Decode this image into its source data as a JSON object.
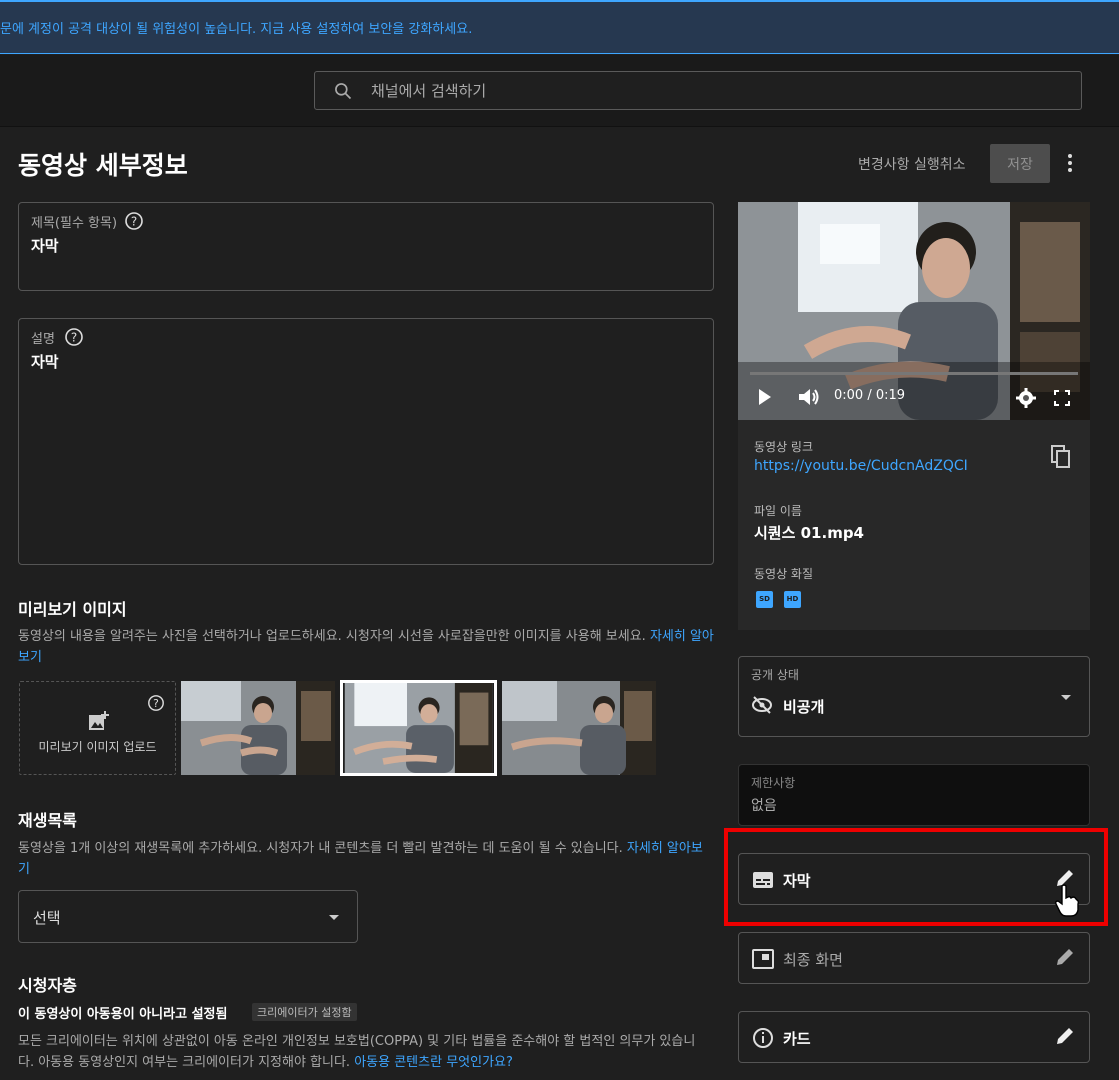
{
  "banner": {
    "text": "문에 계정이 공격 대상이 될 위험성이 높습니다. 지금 사용 설정하여 보안을 강화하세요."
  },
  "search": {
    "placeholder": "채널에서 검색하기"
  },
  "header": {
    "title": "동영상 세부정보",
    "undo_label": "변경사항 실행취소",
    "save_label": "저장"
  },
  "title_field": {
    "label": "제목(필수 항목)",
    "value": "자막"
  },
  "description_field": {
    "label": "설명",
    "value": "자막"
  },
  "thumbnail": {
    "heading": "미리보기 이미지",
    "desc": "동영상의 내용을 알려주는 사진을 선택하거나 업로드하세요. 시청자의 시선을 사로잡을만한 이미지를 사용해 보세요.",
    "learn_more": "자세히 알아보기",
    "upload_label": "미리보기 이미지 업로드"
  },
  "playlist": {
    "heading": "재생목록",
    "desc": "동영상을 1개 이상의 재생목록에 추가하세요. 시청자가 내 콘텐츠를 더 빨리 발견하는 데 도움이 될 수 있습니다.",
    "learn_more": "자세히 알아보기",
    "select_value": "선택"
  },
  "audience": {
    "heading": "시청자층",
    "setting": "이 동영상이 아동용이 아니라고 설정됨",
    "chip": "크리에이터가 설정함",
    "desc": "모든 크리에이터는 위치에 상관없이 아동 온라인 개인정보 보호법(COPPA) 및 기타 법률을 준수해야 할 법적인 의무가 있습니다. 아동용 동영상인지 여부는 크리에이터가 지정해야 합니다.",
    "link": "아동용 콘텐츠란 무엇인가요?"
  },
  "video_card": {
    "time": "0:00 / 0:19",
    "link_label": "동영상 링크",
    "link": "https://youtu.be/CudcnAdZQCI",
    "filename_label": "파일 이름",
    "filename": "시퀀스 01.mp4",
    "quality_label": "동영상 화질",
    "quality_badges": [
      "SD",
      "HD"
    ]
  },
  "visibility": {
    "label": "공개 상태",
    "value": "비공개"
  },
  "restrictions": {
    "label": "제한사항",
    "value": "없음"
  },
  "subtitles": {
    "label": "자막"
  },
  "end_screen": {
    "label": "최종 화면"
  },
  "cards": {
    "label": "카드"
  },
  "colors": {
    "accent": "#3ea6ff",
    "background": "#1f1f1f",
    "highlight": "#e00000"
  }
}
